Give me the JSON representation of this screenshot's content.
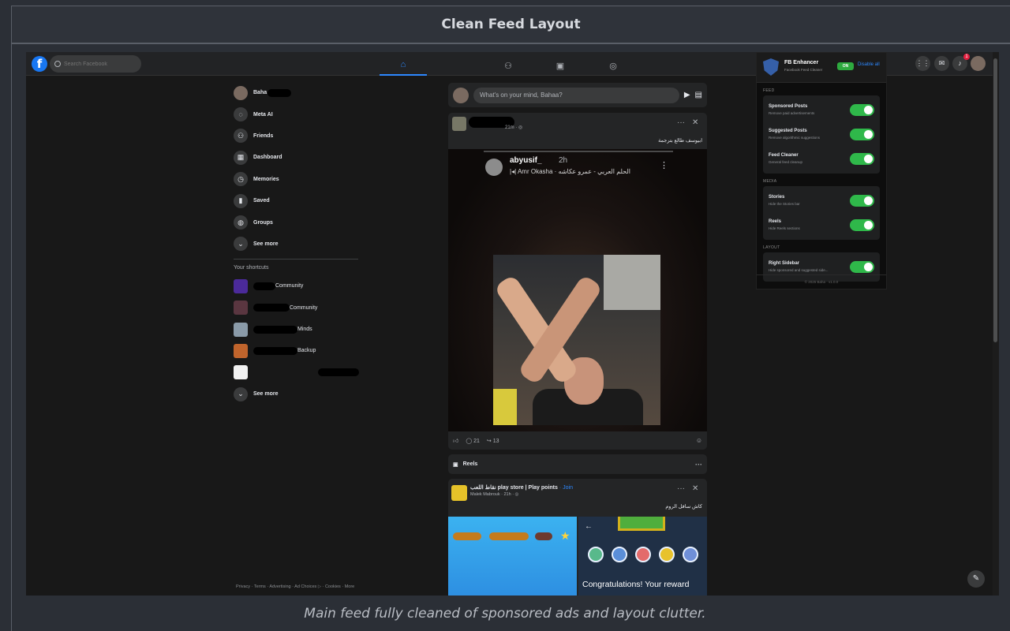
{
  "page": {
    "title": "Clean Feed Layout",
    "caption": "Main feed fully cleaned of sponsored ads and layout clutter."
  },
  "topbar": {
    "logo": "f",
    "search_placeholder": "Search Facebook",
    "tabs": [
      {
        "icon": "home-icon",
        "glyph": "⌂"
      },
      {
        "icon": "friends-icon",
        "glyph": "⚇"
      },
      {
        "icon": "marketplace-icon",
        "glyph": "▣"
      },
      {
        "icon": "groups-icon",
        "glyph": "◎"
      }
    ],
    "right_icons": [
      {
        "icon": "menu-grid-icon",
        "glyph": "⋮⋮"
      },
      {
        "icon": "messenger-icon",
        "glyph": "✉"
      },
      {
        "icon": "bell-icon",
        "glyph": "♪"
      }
    ],
    "notification_count": "1"
  },
  "left_sidebar": {
    "profile_name": "Baha",
    "items": [
      {
        "label": "Meta AI",
        "icon": "meta-ai-icon",
        "glyph": "◌"
      },
      {
        "label": "Friends",
        "icon": "friends-icon",
        "glyph": "⚇"
      },
      {
        "label": "Dashboard",
        "icon": "dashboard-icon",
        "glyph": "▦"
      },
      {
        "label": "Memories",
        "icon": "memories-icon",
        "glyph": "◷"
      },
      {
        "label": "Saved",
        "icon": "bookmark-icon",
        "glyph": "▮"
      },
      {
        "label": "Groups",
        "icon": "groups-icon",
        "glyph": "◍"
      },
      {
        "label": "See more",
        "icon": "chevron-down-icon",
        "glyph": "⌄"
      }
    ],
    "shortcuts_title": "Your shortcuts",
    "shortcuts": [
      {
        "label": "Community"
      },
      {
        "label": "Community"
      },
      {
        "label": "Minds"
      },
      {
        "label": "Backup"
      },
      {
        "label": ""
      }
    ],
    "shortcuts_more": "See more",
    "footer": "Privacy · Terms · Advertising · Ad Choices ▷ · Cookies · More"
  },
  "composer": {
    "placeholder": "What's on your mind, Bahaa?"
  },
  "post1": {
    "meta": "21m · ◎",
    "text": "ابيوسف طالع بترجمة",
    "inner_username": "abyusif_",
    "inner_time": "2h",
    "inner_song": "|◂| Amr Okasha · الحلم العربي - عمرو عكاشه",
    "comments": "21",
    "shares": "13"
  },
  "reels": {
    "label": "Reels"
  },
  "post2": {
    "name": "نقاط اللعب play store | Play points",
    "join": "· Join",
    "sub": "Malek Mabrouk · 21h · ◎",
    "text": "كاش سافل الروم",
    "reward_text": "Congratulations! Your reward"
  },
  "extension": {
    "title": "FB Enhancer",
    "subtitle": "Facebook Feed Cleaner",
    "status": "ON",
    "disable_label": "Disable all",
    "sections": [
      {
        "name": "FEED",
        "rows": [
          {
            "title": "Sponsored Posts",
            "desc": "Remove paid advertisements",
            "enabled": true
          },
          {
            "title": "Suggested Posts",
            "desc": "Remove algorithmic suggestions",
            "enabled": true
          },
          {
            "title": "Feed Cleaner",
            "desc": "General feed cleanup",
            "enabled": true
          }
        ]
      },
      {
        "name": "MEDIA",
        "rows": [
          {
            "title": "Stories",
            "desc": "Hide the Stories bar",
            "enabled": true
          },
          {
            "title": "Reels",
            "desc": "Hide Reels sections",
            "enabled": true
          }
        ]
      },
      {
        "name": "LAYOUT",
        "rows": [
          {
            "title": "Right Sidebar",
            "desc": "Hide sponsored and suggested side...",
            "enabled": true
          }
        ]
      }
    ],
    "footer": "© 2025 Baha · v1.0.0"
  },
  "colors": {
    "accent": "#2d88ff",
    "toggle_on": "#2fb84a",
    "background": "#181818"
  }
}
